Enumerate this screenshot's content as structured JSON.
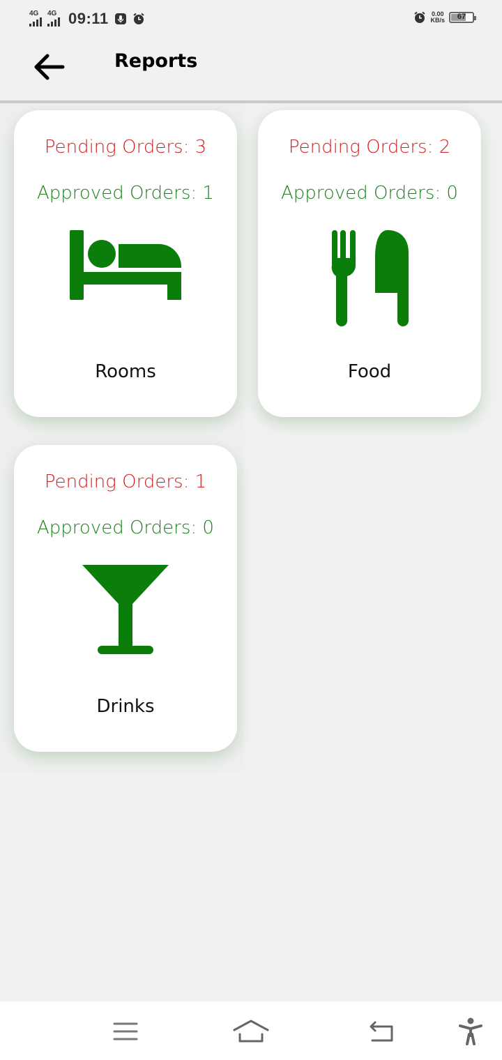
{
  "status_bar": {
    "network_1": "4G",
    "network_2": "4G",
    "time": "09:11",
    "speed_value": "0.00",
    "speed_unit": "KB/s",
    "battery_level": "67",
    "icons": [
      "signal-icon",
      "signal-icon",
      "voice-recorder-icon",
      "alarm-icon",
      "alarm-icon",
      "battery-icon"
    ]
  },
  "app_bar": {
    "title": "Reports",
    "back_icon": "arrow-left-icon"
  },
  "cards": [
    {
      "pending": "Pending Orders: 3",
      "approved": "Approved Orders: 1",
      "label": "Rooms",
      "icon": "bed-icon"
    },
    {
      "pending": "Pending Orders: 2",
      "approved": "Approved Orders: 0",
      "label": "Food",
      "icon": "fork-knife-icon"
    },
    {
      "pending": "Pending Orders: 1",
      "approved": "Approved Orders: 0",
      "label": "Drinks",
      "icon": "cocktail-icon"
    }
  ],
  "colors": {
    "pending": "#d21f1f",
    "approved": "#1b7f1b",
    "icon": "#0a7d0a",
    "background": "#f1f1f1"
  },
  "nav_bar": {
    "icons": [
      "menu-icon",
      "home-icon",
      "back-icon",
      "accessibility-icon"
    ]
  }
}
